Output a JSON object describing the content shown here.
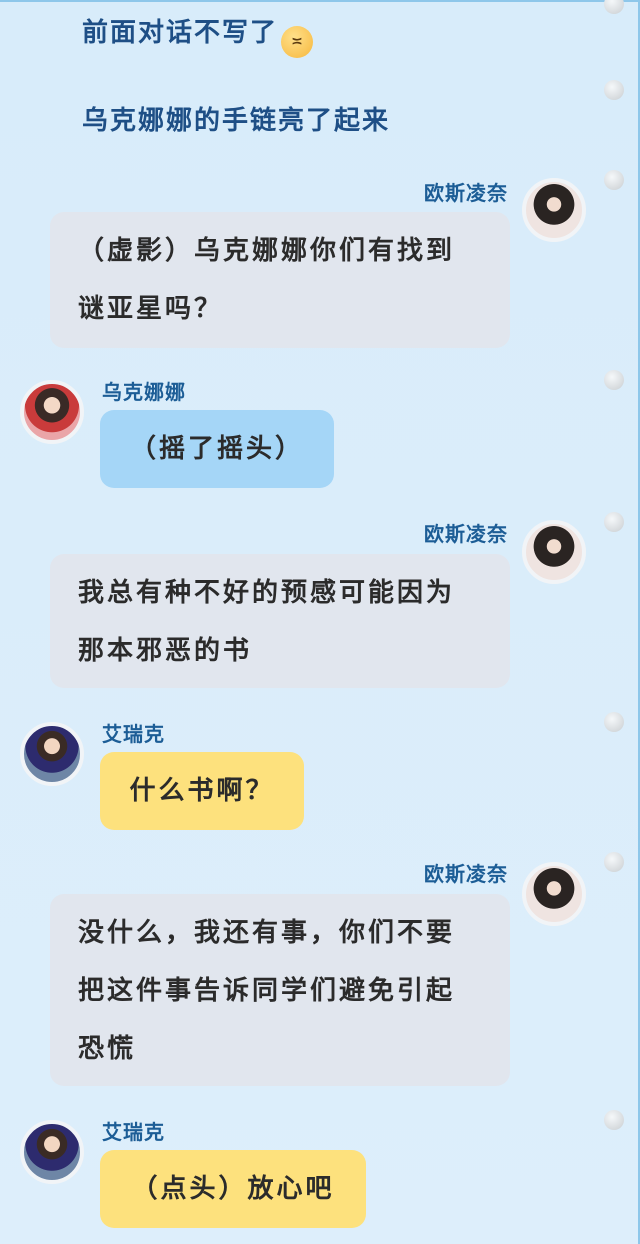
{
  "narration": {
    "line1": "前面对话不写了",
    "line2": "乌克娜娜的手链亮了起来"
  },
  "messages": [
    {
      "speaker": "欧斯凌奈",
      "text": "（虚影）乌克娜娜你们有找到谜亚星吗？"
    },
    {
      "speaker": "乌克娜娜",
      "text": "（摇了摇头）"
    },
    {
      "speaker": "欧斯凌奈",
      "text": "我总有种不好的预感可能因为那本邪恶的书"
    },
    {
      "speaker": "艾瑞克",
      "text": "什么书啊？"
    },
    {
      "speaker": "欧斯凌奈",
      "text": "没什么，我还有事，你们不要把这件事告诉同学们避免引起恐慌"
    },
    {
      "speaker": "艾瑞克",
      "text": "（点头）放心吧"
    }
  ],
  "colors": {
    "background": "#dcedfa",
    "name": "#1c5d96",
    "narration": "#1e4f86",
    "bubble_gray": "#e1e6ee",
    "bubble_blue": "#a5d6f7",
    "bubble_yellow": "#fde17d"
  }
}
